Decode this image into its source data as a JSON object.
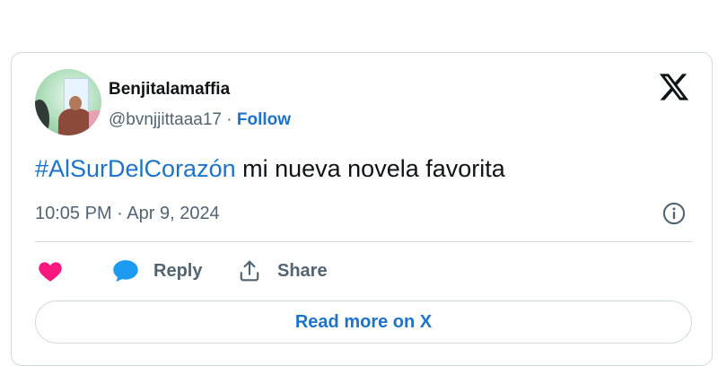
{
  "author": {
    "display_name": "Benjitalamaffia",
    "handle": "@bvnjjittaaa17",
    "separator": " · ",
    "follow_label": "Follow"
  },
  "tweet": {
    "hashtag": "#AlSurDelCorazón",
    "text": " mi nueva novela favorita",
    "timestamp": "10:05 PM · Apr 9, 2024"
  },
  "actions": {
    "reply_label": "Reply",
    "share_label": "Share"
  },
  "read_more_label": "Read more on X",
  "icons": {
    "brand": "x-logo-icon",
    "info": "info-icon",
    "like": "heart-icon",
    "reply": "speech-bubble-icon",
    "share": "share-upload-icon"
  },
  "colors": {
    "link": "#1d73c9",
    "like": "#f91880",
    "reply_icon": "#1d9bf0",
    "secondary_text": "#536471",
    "border": "#cfd9de"
  }
}
